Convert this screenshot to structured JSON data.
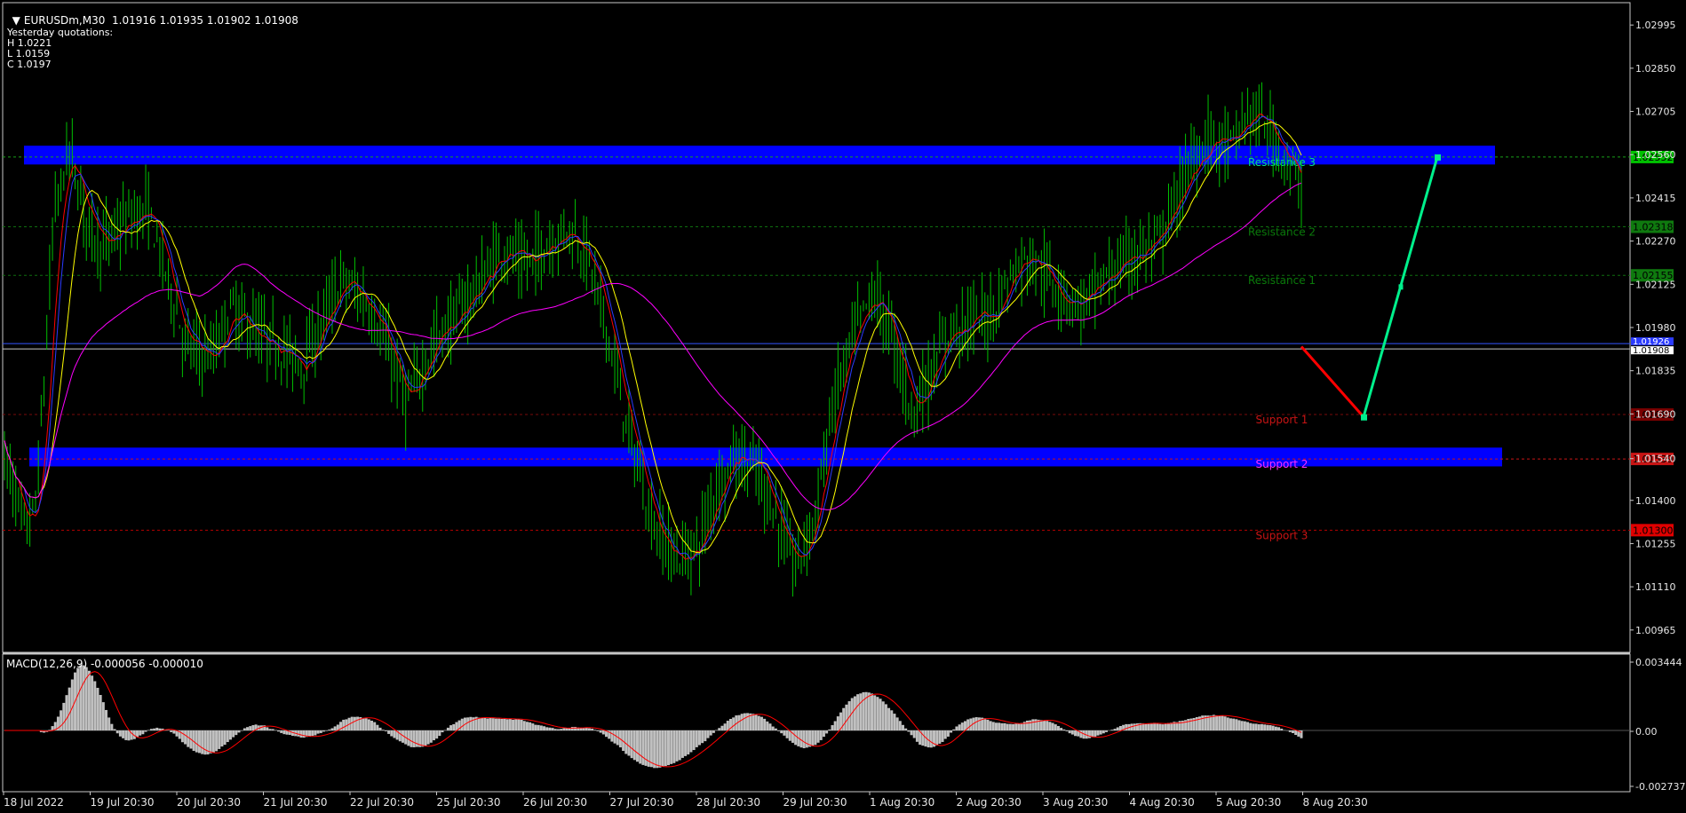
{
  "header": {
    "symbol": "EURUSDm,M30",
    "ohlc": "1.01916 1.01935 1.01902 1.01908",
    "yesterday_title": "Yesterday quotations:",
    "yesterday_high": "H 1.0221",
    "yesterday_low": "L 1.0159",
    "yesterday_close": "C 1.0197"
  },
  "macd": {
    "title": "MACD(12,26,9) -0.000056 -0.000010",
    "ticks": [
      "0.003444",
      "0.00",
      "-0.002737"
    ]
  },
  "colors": {
    "background": "#000000",
    "candles": "#00c000",
    "zone": "#0000ff",
    "resistance_label": "#0a7a0a",
    "resistance3_label": "#00e08a",
    "support_label": "#c81414",
    "support2_label": "#ff2bff",
    "ma_red": "#ff0000",
    "ma_blue": "#2b3bff",
    "ma_yellow": "#ffff00",
    "ma_magenta": "#ff00ff",
    "macd_hist": "#c0c0c0",
    "macd_signal": "#ff0000",
    "forecast_down": "#ff0000",
    "forecast_up": "#00f08c"
  },
  "chart_data": {
    "type": "candlestick",
    "symbol": "EURUSDm",
    "timeframe": "M30",
    "ylim": [
      1.0089,
      1.0307
    ],
    "y_ticks": [
      "1.02995",
      "1.02850",
      "1.02705",
      "1.02560",
      "1.02415",
      "1.02270",
      "1.02125",
      "1.01980",
      "1.01835",
      "1.01690",
      "1.01540",
      "1.01400",
      "1.01255",
      "1.01110",
      "1.00965"
    ],
    "x_labels": [
      "18 Jul 2022",
      "19 Jul 20:30",
      "20 Jul 20:30",
      "21 Jul 20:30",
      "22 Jul 20:30",
      "25 Jul 20:30",
      "26 Jul 20:30",
      "27 Jul 20:30",
      "28 Jul 20:30",
      "29 Jul 20:30",
      "1 Aug 20:30",
      "2 Aug 20:30",
      "3 Aug 20:30",
      "4 Aug 20:30",
      "5 Aug 20:30",
      "8 Aug 20:30"
    ],
    "price_path": [
      [
        0,
        1.0155
      ],
      [
        0.008,
        1.0143
      ],
      [
        0.016,
        1.0129
      ],
      [
        0.024,
        1.0138
      ],
      [
        0.03,
        1.0175
      ],
      [
        0.038,
        1.0235
      ],
      [
        0.05,
        1.0258
      ],
      [
        0.062,
        1.0236
      ],
      [
        0.075,
        1.0225
      ],
      [
        0.09,
        1.0232
      ],
      [
        0.11,
        1.0238
      ],
      [
        0.125,
        1.0216
      ],
      [
        0.14,
        1.0192
      ],
      [
        0.16,
        1.0188
      ],
      [
        0.175,
        1.0205
      ],
      [
        0.19,
        1.0198
      ],
      [
        0.21,
        1.0192
      ],
      [
        0.23,
        1.0186
      ],
      [
        0.26,
        1.0214
      ],
      [
        0.28,
        1.0206
      ],
      [
        0.3,
        1.0186
      ],
      [
        0.31,
        1.0172
      ],
      [
        0.33,
        1.0192
      ],
      [
        0.35,
        1.0203
      ],
      [
        0.37,
        1.0215
      ],
      [
        0.385,
        1.0225
      ],
      [
        0.4,
        1.0218
      ],
      [
        0.42,
        1.0226
      ],
      [
        0.435,
        1.0232
      ],
      [
        0.45,
        1.0222
      ],
      [
        0.465,
        1.0196
      ],
      [
        0.48,
        1.0165
      ],
      [
        0.5,
        1.0132
      ],
      [
        0.52,
        1.012
      ],
      [
        0.535,
        1.0125
      ],
      [
        0.55,
        1.0146
      ],
      [
        0.565,
        1.0155
      ],
      [
        0.58,
        1.015
      ],
      [
        0.595,
        1.0135
      ],
      [
        0.61,
        1.0118
      ],
      [
        0.625,
        1.0135
      ],
      [
        0.64,
        1.0175
      ],
      [
        0.655,
        1.0196
      ],
      [
        0.67,
        1.021
      ],
      [
        0.685,
        1.0195
      ],
      [
        0.7,
        1.017
      ],
      [
        0.715,
        1.0182
      ],
      [
        0.73,
        1.0198
      ],
      [
        0.745,
        1.02
      ],
      [
        0.76,
        1.0202
      ],
      [
        0.775,
        1.0215
      ],
      [
        0.79,
        1.0222
      ],
      [
        0.81,
        1.0212
      ],
      [
        0.83,
        1.0205
      ],
      [
        0.85,
        1.0215
      ],
      [
        0.87,
        1.0222
      ],
      [
        0.89,
        1.0226
      ],
      [
        0.905,
        1.0242
      ],
      [
        0.915,
        1.0254
      ],
      [
        0.93,
        1.0262
      ],
      [
        0.945,
        1.0258
      ],
      [
        0.96,
        1.027
      ],
      [
        0.975,
        1.0265
      ],
      [
        1.0,
        1.0245
      ]
    ],
    "forecast": {
      "start_price": 1.01916,
      "mid_price": 1.0168,
      "end_price": 1.02552
    },
    "levels": [
      {
        "label": "Resistance 3",
        "price": "1.02552"
      },
      {
        "label": "Resistance 2",
        "price": "1.02318"
      },
      {
        "label": "Resistance 1",
        "price": "1.02155"
      },
      {
        "label": "Support 1",
        "price": "1.01688"
      },
      {
        "label": "Support 2",
        "price": "1.01539"
      },
      {
        "label": "Support 3",
        "price": "1.01300"
      }
    ],
    "current_price_labels": [
      "1.01926",
      "1.01908"
    ]
  }
}
